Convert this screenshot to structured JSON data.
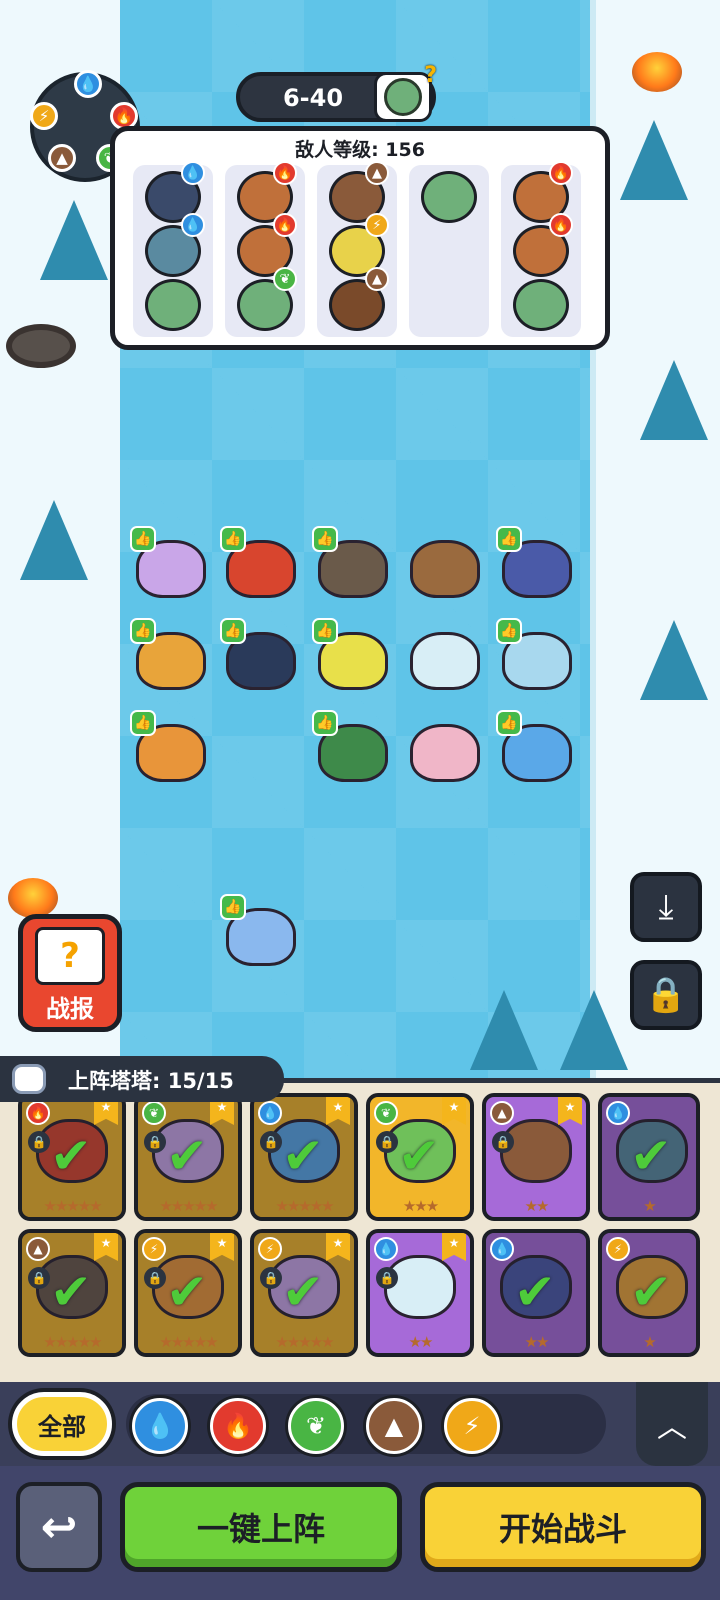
{
  "stage": {
    "label": "6-40",
    "boss_icon": "mystery-boss-icon"
  },
  "enemy_panel": {
    "level_text": "敌人等级: 156",
    "columns": [
      {
        "enemies": [
          {
            "element": "water"
          },
          {
            "element": "water"
          },
          {
            "element": "none"
          }
        ]
      },
      {
        "enemies": [
          {
            "element": "fire"
          },
          {
            "element": "fire"
          },
          {
            "element": "leaf"
          }
        ]
      },
      {
        "enemies": [
          {
            "element": "rock"
          },
          {
            "element": "bolt"
          },
          {
            "element": "rock"
          }
        ]
      },
      {
        "enemies": [
          {
            "element": "none"
          }
        ]
      },
      {
        "enemies": [
          {
            "element": "fire"
          },
          {
            "element": "fire"
          },
          {
            "element": "none"
          }
        ]
      }
    ]
  },
  "element_wheel": {
    "elements": [
      "water",
      "fire",
      "leaf",
      "rock",
      "bolt"
    ]
  },
  "battlefield": {
    "units_placed": 15
  },
  "side_buttons": {
    "report_label": "战报",
    "report_icon": "question-mark-icon",
    "download_icon": "download-icon",
    "lock_icon": "lock-icon"
  },
  "roster": {
    "count_text": "上阵塔塔: 15/15",
    "cards": [
      {
        "element": "fire",
        "stars": "★★★★★",
        "placed": true,
        "frame": "gold"
      },
      {
        "element": "leaf",
        "stars": "★★★★★",
        "placed": true,
        "frame": "gold"
      },
      {
        "element": "water",
        "stars": "★★★★★",
        "placed": true,
        "frame": "gold"
      },
      {
        "element": "leaf",
        "stars": "★★★",
        "placed": true,
        "frame": "gold"
      },
      {
        "element": "rock",
        "stars": "★★",
        "placed": false,
        "frame": "purple"
      },
      {
        "element": "water",
        "stars": "★",
        "placed": true,
        "frame": "purple"
      },
      {
        "element": "rock",
        "stars": "★★★★★",
        "placed": true,
        "frame": "gold"
      },
      {
        "element": "bolt",
        "stars": "★★★★★",
        "placed": true,
        "frame": "gold"
      },
      {
        "element": "bolt",
        "stars": "★★★★★",
        "placed": true,
        "frame": "gold"
      },
      {
        "element": "water",
        "stars": "★★",
        "placed": false,
        "frame": "purple"
      },
      {
        "element": "water",
        "stars": "★★",
        "placed": true,
        "frame": "purple"
      },
      {
        "element": "bolt",
        "stars": "★",
        "placed": true,
        "frame": "purple"
      }
    ]
  },
  "filters": {
    "all_label": "全部",
    "items": [
      "water",
      "fire",
      "leaf",
      "rock",
      "bolt"
    ],
    "collapse_icon": "chevron-up-icon"
  },
  "actions": {
    "back_icon": "return-arrow-icon",
    "auto_deploy_label": "一键上阵",
    "start_battle_label": "开始战斗"
  },
  "colors": {
    "water": "#2f8fe0",
    "fire": "#e23a2e",
    "leaf": "#49b544",
    "rock": "#8a5a3a",
    "bolt": "#f0a818",
    "start_button": "#f9d237",
    "auto_button": "#6fd23a"
  }
}
